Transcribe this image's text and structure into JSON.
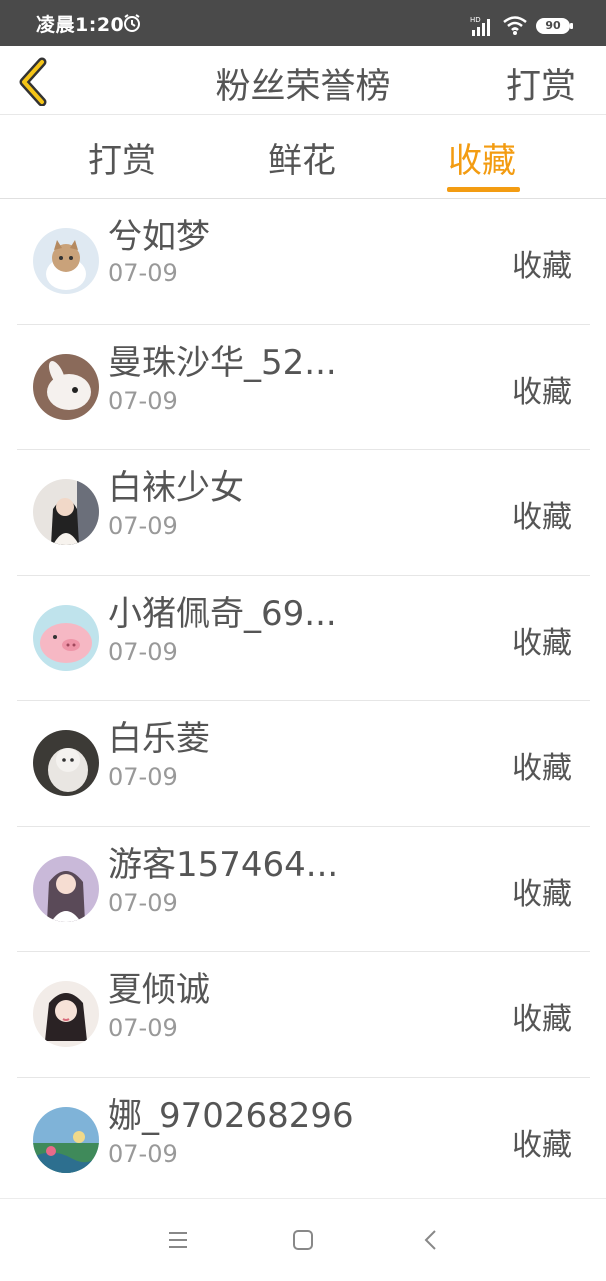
{
  "status_bar": {
    "time": "凌晨1:20",
    "battery": "90",
    "network": "HD"
  },
  "header": {
    "title": "粉丝荣誉榜",
    "right_action": "打赏",
    "back_icon": "chevron-left-icon"
  },
  "tabs": [
    {
      "label": "打赏",
      "active": false
    },
    {
      "label": "鲜花",
      "active": false
    },
    {
      "label": "收藏",
      "active": true
    }
  ],
  "accent_color": "#f39c12",
  "fans": [
    {
      "name": "兮如梦",
      "date": "07-09",
      "action": "收藏"
    },
    {
      "name": "曼珠沙华_52...",
      "date": "07-09",
      "action": "收藏"
    },
    {
      "name": "白袜少女",
      "date": "07-09",
      "action": "收藏"
    },
    {
      "name": "小猪佩奇_69...",
      "date": "07-09",
      "action": "收藏"
    },
    {
      "name": "白乐菱",
      "date": "07-09",
      "action": "收藏"
    },
    {
      "name": "游客157464...",
      "date": "07-09",
      "action": "收藏"
    },
    {
      "name": "夏倾诚",
      "date": "07-09",
      "action": "收藏"
    },
    {
      "name": "娜_970268296",
      "date": "07-09",
      "action": "收藏"
    }
  ],
  "nav_bar": {
    "icons": [
      "menu-icon",
      "home-icon",
      "back-icon"
    ]
  }
}
